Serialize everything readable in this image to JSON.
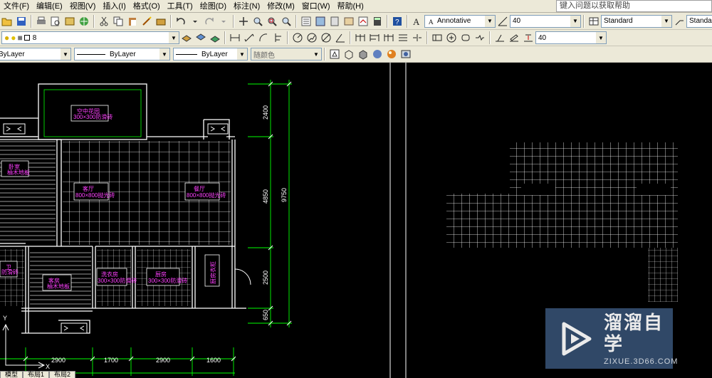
{
  "menu": {
    "items": [
      "文件(F)",
      "编辑(E)",
      "视图(V)",
      "插入(I)",
      "格式(O)",
      "工具(T)",
      "绘图(D)",
      "标注(N)",
      "修改(M)",
      "窗口(W)",
      "帮助(H)"
    ],
    "help_placeholder": "键入问题以获取帮助"
  },
  "toolbar1": {
    "annotative_style": "Annotative",
    "annotation_scale": "40",
    "table_style": "Standard",
    "multileader_style": "Standard"
  },
  "toolbar2": {
    "layer_value": "8",
    "dim_scale": "40"
  },
  "toolbar3": {
    "color": "ByLayer",
    "linetype": "ByLayer",
    "lineweight": "ByLayer",
    "plotstyle": "随颜色"
  },
  "drawing": {
    "dimensions_vertical_inner": [
      "2400",
      "4850",
      "2500",
      "650"
    ],
    "dimension_vertical_total": "9750",
    "dimensions_horizontal": [
      "2900",
      "1700",
      "2900",
      "1600"
    ],
    "rooms": [
      {
        "name": "空中花园",
        "spec": "300×300防滑砖"
      },
      {
        "name": "卧室",
        "spec": "柚木地板"
      },
      {
        "name": "客厅",
        "spec": "800×800抛光砖"
      },
      {
        "name": "餐厅",
        "spec": "800×800抛光砖"
      },
      {
        "name": "卫",
        "spec": "防滑砖"
      },
      {
        "name": "客房",
        "spec": "柚木地板"
      },
      {
        "name": "洗衣房",
        "spec": "300×300防滑砖"
      },
      {
        "name": "厨房",
        "spec": "300×300防滑砖"
      },
      {
        "name": "厨房衣柜",
        "spec": ""
      }
    ],
    "ucs_y": "Y",
    "ucs_x": "X"
  },
  "tabs": [
    "模型",
    "布局1",
    "布局2"
  ],
  "watermark": {
    "title": "溜溜自学",
    "subtitle": "ZIXUE.3D66.COM"
  },
  "colors": {
    "chrome": "#ece9d8",
    "canvas": "#000000",
    "walls": "#ffffff",
    "dims": "#00ff00",
    "labels": "#ff40ff"
  }
}
